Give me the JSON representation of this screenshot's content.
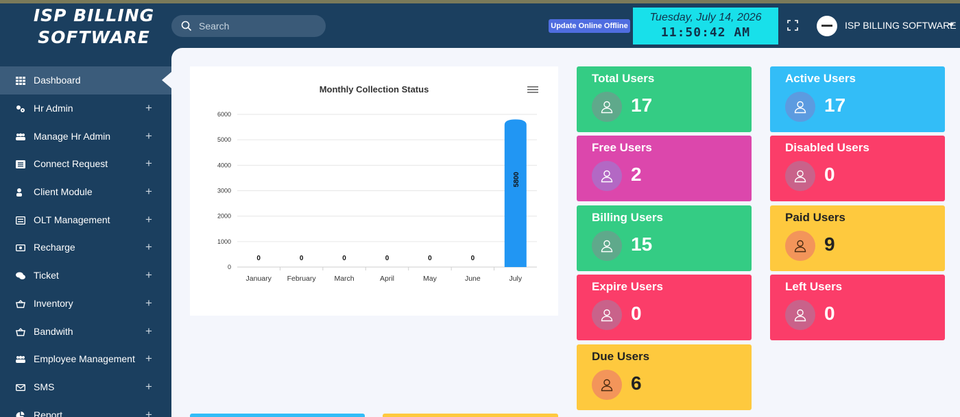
{
  "app": {
    "logo_line1": "ISP BILLING",
    "logo_line2": "SOFTWARE"
  },
  "header": {
    "search_placeholder": "Search",
    "update_badge": "Update Online Offline",
    "date": "Tuesday, July 14, 2026",
    "time": "11:50:42 AM",
    "profile_name": "ISP BILLING SOFTWARE"
  },
  "sidebar": {
    "items": [
      {
        "label": "Dashboard",
        "icon": "grid-icon",
        "active": true
      },
      {
        "label": "Hr Admin",
        "icon": "users-cog-icon"
      },
      {
        "label": "Manage Hr Admin",
        "icon": "users-icon"
      },
      {
        "label": "Connect Request",
        "icon": "list-icon"
      },
      {
        "label": "Client Module",
        "icon": "user-icon"
      },
      {
        "label": "OLT Management",
        "icon": "server-icon"
      },
      {
        "label": "Recharge",
        "icon": "money-icon"
      },
      {
        "label": "Ticket",
        "icon": "comments-icon"
      },
      {
        "label": "Inventory",
        "icon": "basket-icon"
      },
      {
        "label": "Bandwith",
        "icon": "basket-icon"
      },
      {
        "label": "Employee Management",
        "icon": "users-icon"
      },
      {
        "label": "SMS",
        "icon": "envelope-icon"
      },
      {
        "label": "Report",
        "icon": "pie-icon"
      }
    ],
    "expand_glyph": "+"
  },
  "tiles": [
    {
      "label": "Total Users",
      "value": "17",
      "color": "#34cc84",
      "icon_bg": "#5fa98b"
    },
    {
      "label": "Active Users",
      "value": "17",
      "color": "#33bdf7",
      "icon_bg": "#5c9be0"
    },
    {
      "label": "Free Users",
      "value": "2",
      "color": "#dc47ac",
      "icon_bg": "#b368c4"
    },
    {
      "label": "Disabled Users",
      "value": "0",
      "color": "#fb3d69",
      "icon_bg": "#c9628a"
    },
    {
      "label": "Billing Users",
      "value": "15",
      "color": "#34cc84",
      "icon_bg": "#5fa98b"
    },
    {
      "label": "Paid Users",
      "value": "9",
      "color": "#fec93e",
      "icon_bg": "#f3955a",
      "dark": true
    },
    {
      "label": "Expire Users",
      "value": "0",
      "color": "#fb3d69",
      "icon_bg": "#c9628a"
    },
    {
      "label": "Left Users",
      "value": "0",
      "color": "#fb3d69",
      "icon_bg": "#c9628a"
    },
    {
      "label": "Due Users",
      "value": "6",
      "color": "#fec93e",
      "icon_bg": "#f3955a",
      "dark": true
    }
  ],
  "chart_data": {
    "type": "bar",
    "title": "Monthly Collection Status",
    "categories": [
      "January",
      "February",
      "March",
      "April",
      "May",
      "June",
      "July"
    ],
    "values": [
      0,
      0,
      0,
      0,
      0,
      0,
      5800
    ],
    "ylim": [
      0,
      6000
    ],
    "yticks": [
      0,
      1000,
      2000,
      3000,
      4000,
      5000,
      6000
    ],
    "bar_color": "#2196f3",
    "grid": true
  },
  "bottom_strips": [
    {
      "color": "#33bdf7"
    },
    {
      "color": "#fec93e"
    }
  ]
}
